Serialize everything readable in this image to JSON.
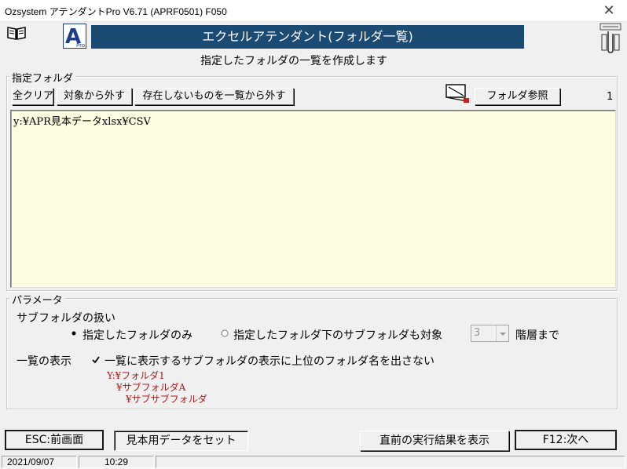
{
  "window": {
    "title": "Ozsystem アテンダントPro V6.71 (APRF0501)  F050",
    "close_glyph": "✕"
  },
  "header": {
    "banner": "エクセルアテンダント(フォルダ一覧)",
    "subtitle": "指定したフォルダの一覧を作成します"
  },
  "folders": {
    "group_title": "指定フォルダ",
    "clear_all": "全クリア",
    "remove_target": "対象から外す",
    "remove_missing": "存在しないものを一覧から外す",
    "browse": "フォルダ参照",
    "count": "1",
    "list": [
      "y:¥APR見本データxlsx¥CSV"
    ]
  },
  "params": {
    "group_title": "パラメータ",
    "subfolder_label": "サブフォルダの扱い",
    "radio_only": "指定したフォルダのみ",
    "radio_sub": "指定したフォルダ下のサブフォルダも対象",
    "depth_value": "3",
    "depth_suffix": "階層まで",
    "list_display_label": "一覧の表示",
    "hide_parent_label": "一覧に表示するサブフォルダの表示に上位のフォルダ名を出さない",
    "example": [
      "Y:¥フォルダ1",
      "¥サブフォルダA",
      "¥サブサブフォルダ"
    ],
    "example_color": "#b01818"
  },
  "footer": {
    "esc": "ESC:前画面",
    "sample": "見本用データをセット",
    "show_last": "直前の実行結果を表示",
    "next": "F12:次へ"
  },
  "status": {
    "date": "2021/09/07",
    "time": "10:29"
  },
  "colors": {
    "banner_bg": "#1b4a73",
    "list_bg": "#fdfde2"
  }
}
